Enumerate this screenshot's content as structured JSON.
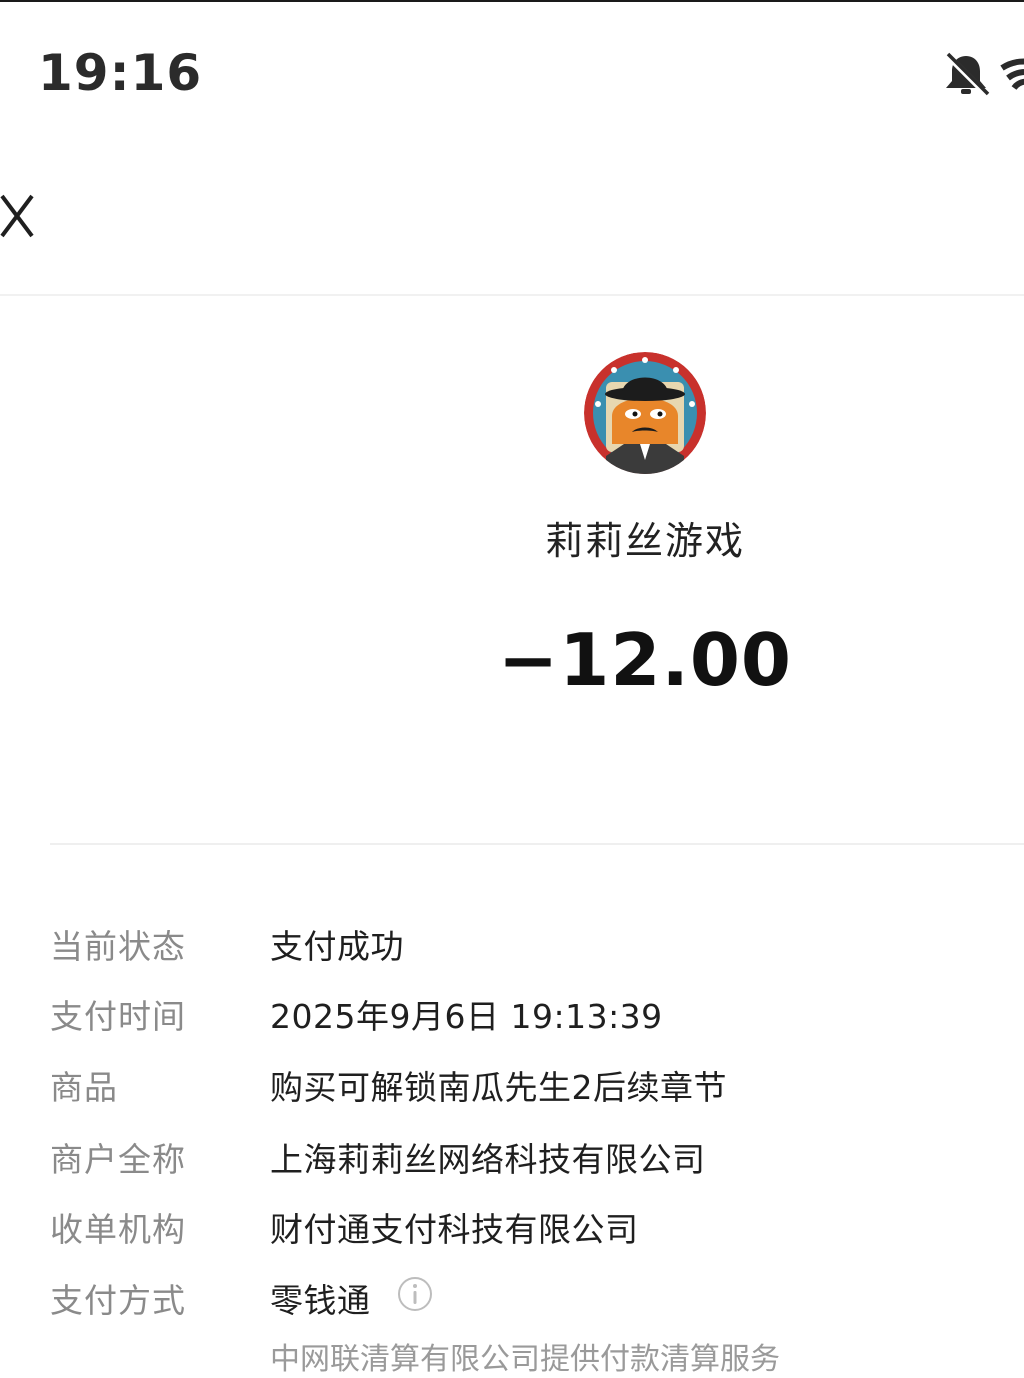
{
  "status_bar": {
    "time": "19:16",
    "icons": [
      "bell-off-icon",
      "wifi-icon"
    ]
  },
  "header": {
    "close_icon": "close-icon"
  },
  "merchant": {
    "name": "莉莉丝游戏",
    "amount": "−12.00",
    "avatar": "merchant-avatar"
  },
  "details": [
    {
      "label": "当前状态",
      "value": "支付成功"
    },
    {
      "label": "支付时间",
      "value": "2025年9月6日 19:13:39"
    },
    {
      "label": "商品",
      "value": "购买可解锁南瓜先生2后续章节"
    },
    {
      "label": "商户全称",
      "value": "上海莉莉丝网络科技有限公司"
    },
    {
      "label": "收单机构",
      "value": "财付通支付科技有限公司"
    },
    {
      "label": "支付方式",
      "value": "零钱通"
    }
  ],
  "clearing_note": "中网联清算有限公司提供付款清算服务",
  "colors": {
    "label": "#8a8a8a",
    "value": "#1f1f1f",
    "divider": "#efefef"
  }
}
